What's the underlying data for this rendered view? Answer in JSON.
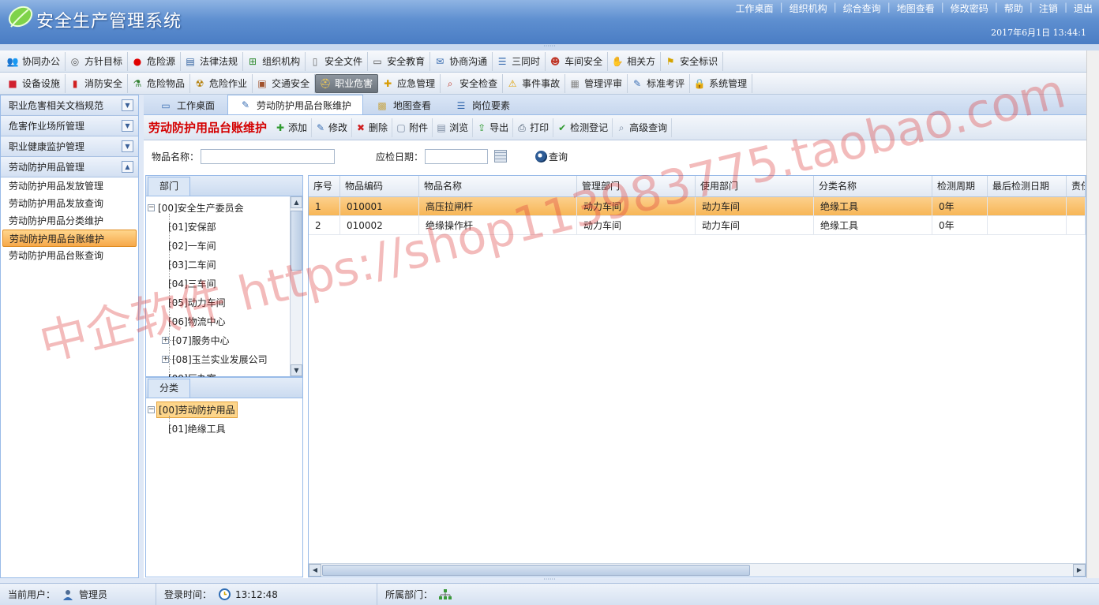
{
  "app": {
    "title": "安全生产管理系统",
    "datetime": "2017年6月1日 13:44:1",
    "top_links": [
      "工作桌面",
      "组织机构",
      "综合查询",
      "地图查看",
      "修改密码",
      "帮助",
      "注销",
      "退出"
    ]
  },
  "menu_row1": [
    {
      "label": "协同办公",
      "icon": "people-icon"
    },
    {
      "label": "方针目标",
      "icon": "target-icon"
    },
    {
      "label": "危险源",
      "icon": "red-dot-icon"
    },
    {
      "label": "法律法规",
      "icon": "book-icon"
    },
    {
      "label": "组织机构",
      "icon": "org-chart-icon"
    },
    {
      "label": "安全文件",
      "icon": "document-icon"
    },
    {
      "label": "安全教育",
      "icon": "speech-bubble-icon"
    },
    {
      "label": "协商沟通",
      "icon": "mail-icon"
    },
    {
      "label": "三同时",
      "icon": "list-icon"
    },
    {
      "label": "车间安全",
      "icon": "worker-icon"
    },
    {
      "label": "相关方",
      "icon": "handshake-icon"
    },
    {
      "label": "安全标识",
      "icon": "flag-icon"
    }
  ],
  "menu_row2": [
    {
      "label": "设备设施",
      "icon": "device-icon"
    },
    {
      "label": "消防安全",
      "icon": "extinguisher-icon"
    },
    {
      "label": "危险物品",
      "icon": "flask-icon"
    },
    {
      "label": "危险作业",
      "icon": "hazard-icon"
    },
    {
      "label": "交通安全",
      "icon": "vehicle-icon"
    },
    {
      "label": "职业危害",
      "icon": "helmet-icon",
      "active": true
    },
    {
      "label": "应急管理",
      "icon": "emergency-icon"
    },
    {
      "label": "安全检查",
      "icon": "magnifier-icon"
    },
    {
      "label": "事件事故",
      "icon": "warning-icon"
    },
    {
      "label": "管理评审",
      "icon": "review-icon"
    },
    {
      "label": "标准考评",
      "icon": "edit-icon"
    },
    {
      "label": "系统管理",
      "icon": "lock-icon"
    }
  ],
  "left_nav": {
    "groups": [
      "职业危害相关文档规范",
      "危害作业场所管理",
      "职业健康监护管理",
      "劳动防护用品管理"
    ],
    "items": [
      "劳动防护用品发放管理",
      "劳动防护用品发放查询",
      "劳动防护用品分类维护",
      "劳动防护用品台账维护",
      "劳动防护用品台账查询"
    ],
    "active_item": "劳动防护用品台账维护"
  },
  "tabs": [
    {
      "label": "工作桌面",
      "icon": "desktop-icon"
    },
    {
      "label": "劳动防护用品台账维护",
      "icon": "edit-icon",
      "active": true
    },
    {
      "label": "地图查看",
      "icon": "map-icon"
    },
    {
      "label": "岗位要素",
      "icon": "list-icon"
    }
  ],
  "page": {
    "title": "劳动防护用品台账维护",
    "actions": [
      {
        "label": "添加",
        "icon": "add-icon"
      },
      {
        "label": "修改",
        "icon": "edit-icon"
      },
      {
        "label": "删除",
        "icon": "delete-icon"
      },
      {
        "label": "附件",
        "icon": "attachment-icon"
      },
      {
        "label": "浏览",
        "icon": "browse-icon"
      },
      {
        "label": "导出",
        "icon": "export-icon"
      },
      {
        "label": "打印",
        "icon": "print-icon"
      },
      {
        "label": "检测登记",
        "icon": "check-register-icon"
      },
      {
        "label": "高级查询",
        "icon": "advanced-search-icon"
      }
    ]
  },
  "search": {
    "name_label": "物品名称：",
    "name_value": "",
    "date_label": "应检日期：",
    "date_value": "",
    "query_label": "查询"
  },
  "dept_tree": {
    "tab_label": "部门",
    "root": "[00]安全生产委员会",
    "children": [
      {
        "label": "[01]安保部",
        "expandable": false
      },
      {
        "label": "[02]一车间",
        "expandable": false
      },
      {
        "label": "[03]二车间",
        "expandable": false
      },
      {
        "label": "[04]三车间",
        "expandable": false
      },
      {
        "label": "[05]动力车间",
        "expandable": false
      },
      {
        "label": "[06]物流中心",
        "expandable": false
      },
      {
        "label": "[07]服务中心",
        "expandable": true
      },
      {
        "label": "[08]玉兰实业发展公司",
        "expandable": true
      },
      {
        "label": "[09]厂办室",
        "expandable": false
      }
    ]
  },
  "cat_tree": {
    "tab_label": "分类",
    "root": "[00]劳动防护用品",
    "children": [
      "[01]绝缘工具"
    ]
  },
  "grid": {
    "columns": [
      "序号",
      "物品编码",
      "物品名称",
      "管理部门",
      "使用部门",
      "分类名称",
      "检测周期",
      "最后检测日期",
      "责任"
    ],
    "rows": [
      [
        "1",
        "010001",
        "高压拉闸杆",
        "动力车间",
        "动力车间",
        "绝缘工具",
        "0年",
        "",
        ""
      ],
      [
        "2",
        "010002",
        "绝缘操作杆",
        "动力车间",
        "动力车间",
        "绝缘工具",
        "0年",
        "",
        ""
      ]
    ],
    "selected_row": 0
  },
  "status": {
    "user_label": "当前用户：",
    "user_value": "管理员",
    "login_label": "登录时间：",
    "login_value": "13:12:48",
    "dept_label": "所属部门："
  },
  "watermark": "中企软件 https://shop113983775.taobao.com",
  "colors": {
    "accent_blue": "#5e8fd0",
    "title_red": "#d40000",
    "selection_orange": "#f7b657",
    "border_blue": "#99bbe8"
  }
}
